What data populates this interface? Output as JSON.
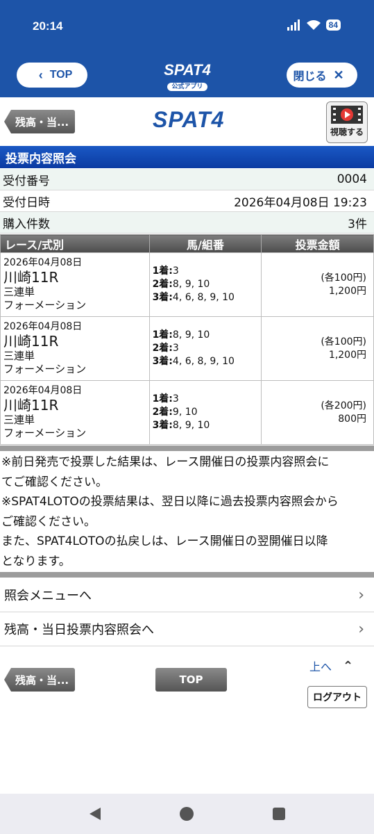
{
  "status_bar": {
    "time": "20:14",
    "battery": "84"
  },
  "app_header": {
    "top_label": "TOP",
    "logo_word": "SPAT4",
    "logo_sub": "公式アプリ",
    "close_label": "閉じる"
  },
  "page_nav": {
    "back_label": "残高・当...",
    "logo": "SPAT4",
    "watch_label": "視聴する"
  },
  "section_title": "投票内容照会",
  "info": {
    "receipt_label": "受付番号",
    "receipt_value": "0004",
    "datetime_label": "受付日時",
    "datetime_value": "2026年04月08日 19:23",
    "count_label": "購入件数",
    "count_value": "3件"
  },
  "table": {
    "headers": [
      "レース/式別",
      "馬/組番",
      "投票金額"
    ],
    "rows": [
      {
        "date": "2026年04月08日",
        "race": "川崎11R",
        "bet_type": "三連単",
        "method": "フォーメーション",
        "first_label": "1着:",
        "first": "3",
        "second_label": "2着:",
        "second": "8, 9, 10",
        "third_label": "3着:",
        "third": "4, 6, 8, 9, 10",
        "unit": "(各100円)",
        "total": "1,200円"
      },
      {
        "date": "2026年04月08日",
        "race": "川崎11R",
        "bet_type": "三連単",
        "method": "フォーメーション",
        "first_label": "1着:",
        "first": "8, 9, 10",
        "second_label": "2着:",
        "second": "3",
        "third_label": "3着:",
        "third": "4, 6, 8, 9, 10",
        "unit": "(各100円)",
        "total": "1,200円"
      },
      {
        "date": "2026年04月08日",
        "race": "川崎11R",
        "bet_type": "三連単",
        "method": "フォーメーション",
        "first_label": "1着:",
        "first": "3",
        "second_label": "2着:",
        "second": "9, 10",
        "third_label": "3着:",
        "third": "8, 9, 10",
        "unit": "(各200円)",
        "total": "800円"
      }
    ]
  },
  "notes": {
    "note1_a": "※前日発売で投票した結果は、レース開催日の投票内容照会に",
    "note1_b": "てご確認ください。",
    "note2_a": "※SPAT4LOTOの投票結果は、翌日以降に過去投票内容照会から",
    "note2_b": "ご確認ください。",
    "note3_a": "また、SPAT4LOTOの払戻しは、レース開催日の翌開催日以降",
    "note3_b": "となります。"
  },
  "menu": {
    "inquiry_menu": "照会メニューへ",
    "balance_inquiry": "残高・当日投票内容照会へ"
  },
  "footer": {
    "back_label": "残高・当...",
    "top_label": "TOP",
    "to_top_label": "上へ",
    "logout_label": "ログアウト"
  },
  "colors": {
    "brand_blue": "#1d54a8",
    "section_blue": "#0b3ba2",
    "button_gray": "#555555"
  },
  "icons": {
    "back": "chevron-left-icon",
    "close": "close-icon",
    "watch": "video-play-icon",
    "menu_link": "chevron-right-icon",
    "up": "chevron-up-icon"
  }
}
